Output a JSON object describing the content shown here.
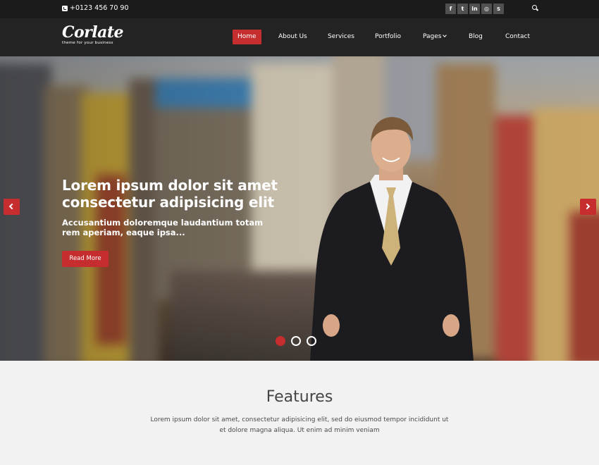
{
  "topbar": {
    "phone": "+0123 456 70 90",
    "socials": [
      {
        "icon": "facebook-icon",
        "glyph": "f"
      },
      {
        "icon": "twitter-icon",
        "glyph": "t"
      },
      {
        "icon": "linkedin-icon",
        "glyph": "in"
      },
      {
        "icon": "dribbble-icon",
        "glyph": "◎"
      },
      {
        "icon": "skype-icon",
        "glyph": "S"
      }
    ],
    "search_icon": "search-icon"
  },
  "header": {
    "logo": "Corlate",
    "tagline": "theme for your business",
    "nav": [
      {
        "label": "Home",
        "active": true
      },
      {
        "label": "About Us",
        "active": false
      },
      {
        "label": "Services",
        "active": false
      },
      {
        "label": "Portfolio",
        "active": false
      },
      {
        "label": "Pages",
        "active": false,
        "dropdown": true
      },
      {
        "label": "Blog",
        "active": false
      },
      {
        "label": "Contact",
        "active": false
      }
    ]
  },
  "hero": {
    "title": "Lorem ipsum dolor sit amet consectetur adipisicing elit",
    "subtitle": "Accusantium doloremque laudantium totam rem aperiam, eaque ipsa...",
    "button": "Read More",
    "slides": 3,
    "active_slide": 1
  },
  "features": {
    "title": "Features",
    "text": "Lorem ipsum dolor sit amet, consectetur adipisicing elit, sed do eiusmod tempor incididunt ut et dolore magna aliqua. Ut enim ad minim veniam"
  },
  "colors": {
    "accent": "#c52d2f",
    "topbar": "#1b1b1b",
    "header": "#232323",
    "page_bg": "#f2f2f2"
  }
}
